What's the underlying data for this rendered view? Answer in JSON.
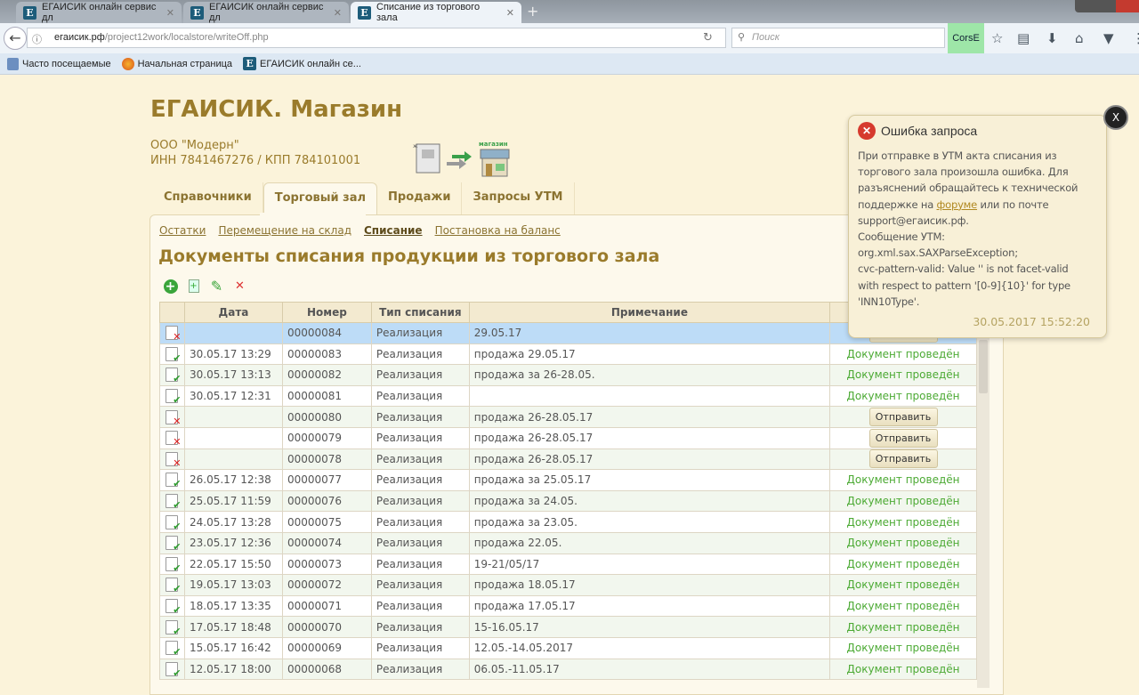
{
  "browser": {
    "tabs": [
      {
        "title": "ЕГАИСИК онлайн сервис дл"
      },
      {
        "title": "ЕГАИСИК онлайн сервис дл"
      },
      {
        "title": "Списание из торгового зала"
      }
    ],
    "url_host": "егаисик.рф",
    "url_path": "/project12work/localstore/writeOff.php",
    "search_placeholder": "Поиск",
    "corse_label": "CorsE",
    "bookmarks": [
      {
        "label": "Часто посещаемые",
        "icon": "bookmark-folder-icon"
      },
      {
        "label": "Начальная страница",
        "icon": "firefox-icon"
      },
      {
        "label": "ЕГАИСИК онлайн се...",
        "icon": "egaisik-favicon"
      }
    ]
  },
  "header": {
    "title": "ЕГАИСИК. Магазин",
    "org_name": "ООО \"Модерн\"",
    "org_ids": "ИНН 7841467276 / КПП 784101001",
    "logo_journal": "журнал",
    "logo_shop": "магазин"
  },
  "main_tabs": [
    {
      "label": "Справочники"
    },
    {
      "label": "Торговый зал",
      "active": true
    },
    {
      "label": "Продажи"
    },
    {
      "label": "Запросы УТМ"
    }
  ],
  "subnav": [
    {
      "label": "Остатки"
    },
    {
      "label": "Перемещение на склад"
    },
    {
      "label": "Списание",
      "active": true
    },
    {
      "label": "Постановка на баланс"
    }
  ],
  "page_title": "Документы списания продукции из торгового зала",
  "table": {
    "columns": [
      "",
      "Дата",
      "Номер",
      "Тип списания",
      "Примечание",
      ""
    ],
    "rows": [
      {
        "status": "draft",
        "date": "",
        "number": "00000084",
        "type": "Реализация",
        "note": "29.05.17",
        "action": "Отправить",
        "selected": true
      },
      {
        "status": "done",
        "date": "30.05.17 13:29",
        "number": "00000083",
        "type": "Реализация",
        "note": "продажа 29.05.17",
        "action": "Документ проведён"
      },
      {
        "status": "done",
        "date": "30.05.17 13:13",
        "number": "00000082",
        "type": "Реализация",
        "note": "продажа за 26-28.05.",
        "action": "Документ проведён"
      },
      {
        "status": "done",
        "date": "30.05.17 12:31",
        "number": "00000081",
        "type": "Реализация",
        "note": "",
        "action": "Документ проведён"
      },
      {
        "status": "draft",
        "date": "",
        "number": "00000080",
        "type": "Реализация",
        "note": "продажа 26-28.05.17",
        "action": "Отправить"
      },
      {
        "status": "draft",
        "date": "",
        "number": "00000079",
        "type": "Реализация",
        "note": "продажа 26-28.05.17",
        "action": "Отправить"
      },
      {
        "status": "draft",
        "date": "",
        "number": "00000078",
        "type": "Реализация",
        "note": "продажа 26-28.05.17",
        "action": "Отправить"
      },
      {
        "status": "done",
        "date": "26.05.17 12:38",
        "number": "00000077",
        "type": "Реализация",
        "note": "продажа за 25.05.17",
        "action": "Документ проведён"
      },
      {
        "status": "done",
        "date": "25.05.17 11:59",
        "number": "00000076",
        "type": "Реализация",
        "note": "продажа за 24.05.",
        "action": "Документ проведён"
      },
      {
        "status": "done",
        "date": "24.05.17 13:28",
        "number": "00000075",
        "type": "Реализация",
        "note": "продажа за 23.05.",
        "action": "Документ проведён"
      },
      {
        "status": "done",
        "date": "23.05.17 12:36",
        "number": "00000074",
        "type": "Реализация",
        "note": "продажа 22.05.",
        "action": "Документ проведён"
      },
      {
        "status": "done",
        "date": "22.05.17 15:50",
        "number": "00000073",
        "type": "Реализация",
        "note": "19-21/05/17",
        "action": "Документ проведён"
      },
      {
        "status": "done",
        "date": "19.05.17 13:03",
        "number": "00000072",
        "type": "Реализация",
        "note": "продажа 18.05.17",
        "action": "Документ проведён"
      },
      {
        "status": "done",
        "date": "18.05.17 13:35",
        "number": "00000071",
        "type": "Реализация",
        "note": "продажа 17.05.17",
        "action": "Документ проведён"
      },
      {
        "status": "done",
        "date": "17.05.17 18:48",
        "number": "00000070",
        "type": "Реализация",
        "note": "15-16.05.17",
        "action": "Документ проведён"
      },
      {
        "status": "done",
        "date": "15.05.17 16:42",
        "number": "00000069",
        "type": "Реализация",
        "note": "12.05.-14.05.2017",
        "action": "Документ проведён"
      },
      {
        "status": "done",
        "date": "12.05.17 18:00",
        "number": "00000068",
        "type": "Реализация",
        "note": "06.05.-11.05.17",
        "action": "Документ проведён"
      }
    ]
  },
  "toast": {
    "title": "Ошибка запроса",
    "msg_before": "При отправке в УТМ акта списания из\nторгового зала произошла ошибка. Для\nразъяснений обращайтесь к технической\nподдержке на ",
    "link": "форуме",
    "msg_after": " или по почте\nsupport@егаисик.рф.\nСообщение УТМ:\norg.xml.sax.SAXParseException;\ncvc-pattern-valid: Value '' is not facet-valid\nwith respect to pattern '[0-9]{10}' for type\n'INN10Type'.",
    "time": "30.05.2017 15:52:20",
    "close": "X"
  },
  "colors": {
    "accent": "#9a7b2b",
    "done": "#4caa34",
    "selected_row": "#bddcf7",
    "error": "#d63a2e"
  }
}
